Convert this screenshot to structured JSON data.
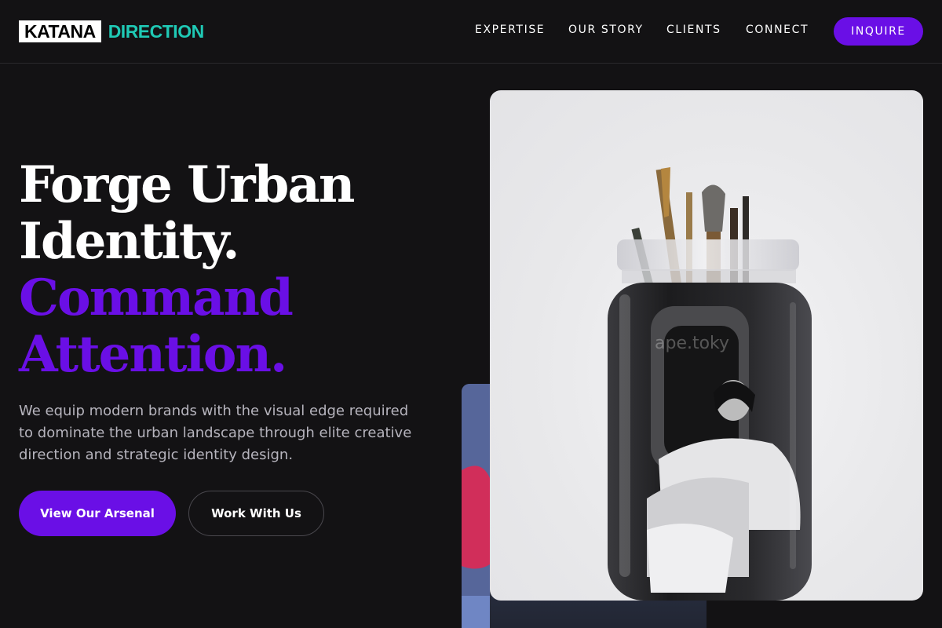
{
  "brand": {
    "part1": "KATANA",
    "part2": "DIRECTION"
  },
  "nav": {
    "items": [
      "EXPERTISE",
      "OUR STORY",
      "CLIENTS",
      "CONNECT"
    ],
    "cta": "INQUIRE"
  },
  "hero": {
    "headline_line1": "Forge Urban",
    "headline_line2": "Identity.",
    "headline_line3": "Command",
    "headline_line4": "Attention.",
    "subtext": "We equip modern brands with the visual edge required to dominate the urban landscape through elite creative direction and strategic identity design.",
    "primary_button": "View Our Arsenal",
    "secondary_button": "Work With Us"
  },
  "images": {
    "front_watermark": "ape.toky"
  },
  "colors": {
    "accent_purple": "#6a0fe6",
    "accent_teal": "#1fc9b5",
    "background": "#131214"
  }
}
